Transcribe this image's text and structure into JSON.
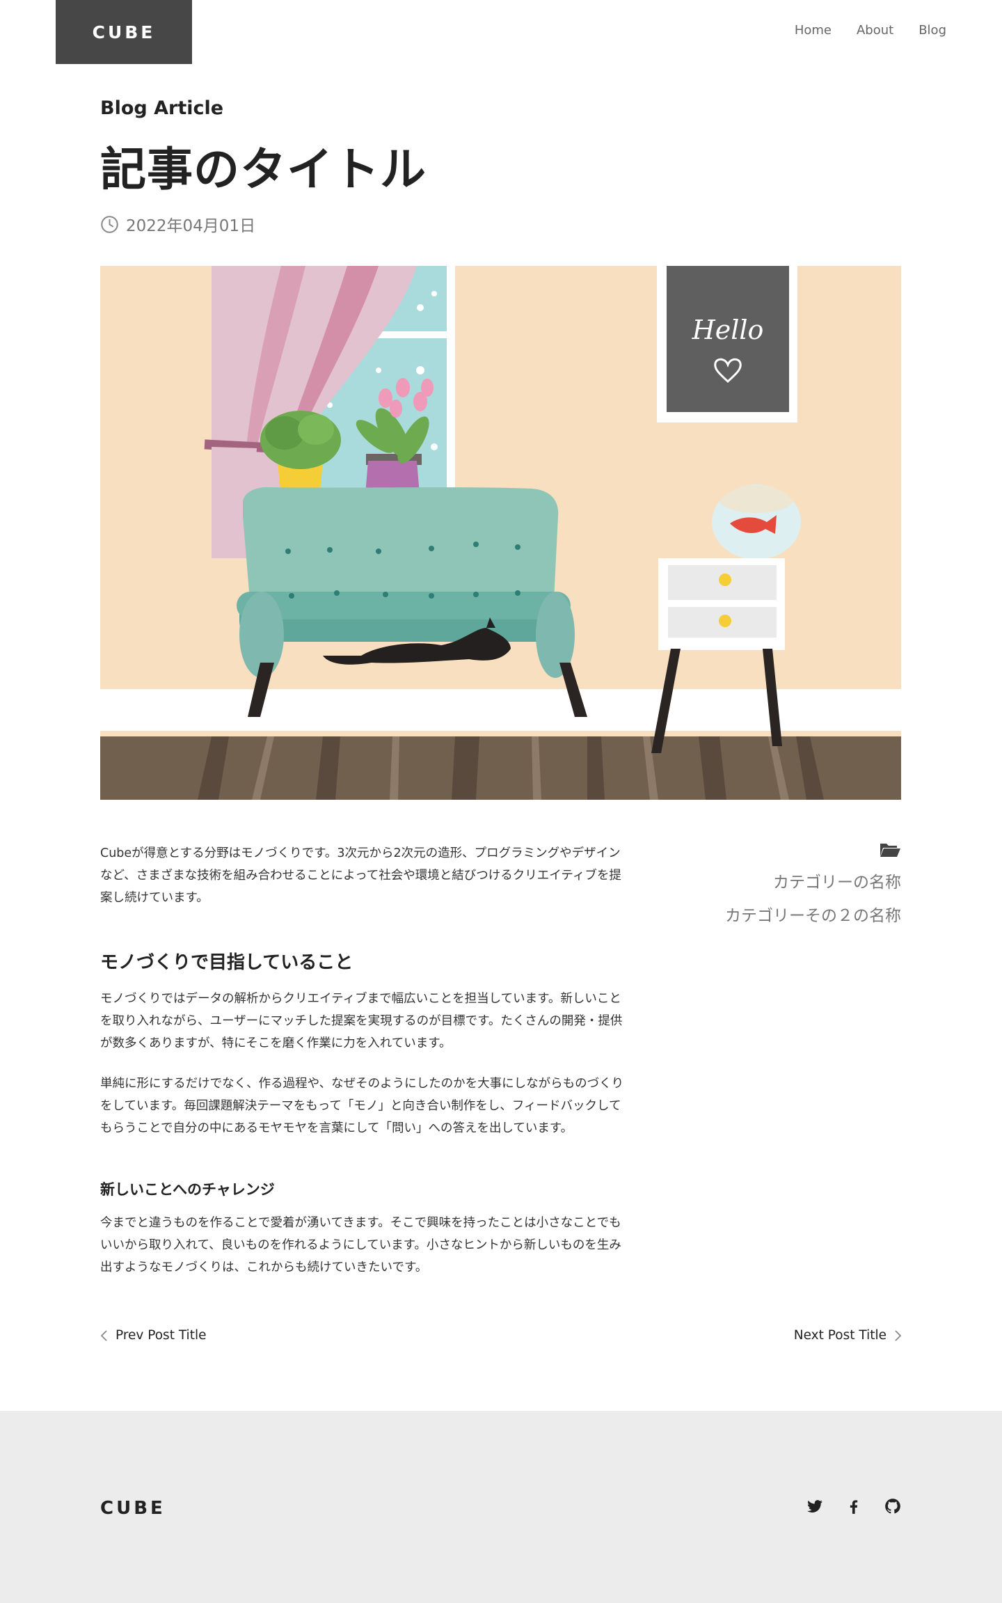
{
  "header": {
    "logo": "CUBE",
    "nav": [
      {
        "label": "Home"
      },
      {
        "label": "About"
      },
      {
        "label": "Blog"
      }
    ]
  },
  "article": {
    "eyebrow": "Blog Article",
    "title": "記事のタイトル",
    "date": "2022年04月01日",
    "hero_text": "Hello",
    "intro": "Cubeが得意とする分野はモノづくりです。3次元から2次元の造形、プログラミングやデザインなど、さまざまな技術を組み合わせることによって社会や環境と結びつけるクリエイティブを提案し続けています。",
    "h2": "モノづくりで目指していること",
    "p2": "モノづくりではデータの解析からクリエイティブまで幅広いことを担当しています。新しいことを取り入れながら、ユーザーにマッチした提案を実現するのが目標です。たくさんの開発・提供が数多くありますが、特にそこを磨く作業に力を入れています。",
    "p3": "単純に形にするだけでなく、作る過程や、なぜそのようにしたのかを大事にしながらものづくりをしています。毎回課題解決テーマをもって「モノ」と向き合い制作をし、フィードバックしてもらうことで自分の中にあるモヤモヤを言葉にして「問い」への答えを出しています。",
    "h3": "新しいことへのチャレンジ",
    "p4": "今までと違うものを作ることで愛着が湧いてきます。そこで興味を持ったことは小さなことでもいいから取り入れて、良いものを作れるようにしています。小さなヒントから新しいものを生み出すようなモノづくりは、これからも続けていきたいです。"
  },
  "categories": [
    {
      "label": "カテゴリーの名称"
    },
    {
      "label": "カテゴリーその２の名称"
    }
  ],
  "pager": {
    "prev": "Prev Post Title",
    "next": "Next Post Title"
  },
  "footer": {
    "logo": "CUBE",
    "social": [
      "twitter-icon",
      "facebook-icon",
      "github-icon"
    ]
  },
  "colors": {
    "header_logo_bg": "#474747",
    "footer_bg": "#ececec",
    "text": "#222222",
    "muted": "#777777"
  }
}
